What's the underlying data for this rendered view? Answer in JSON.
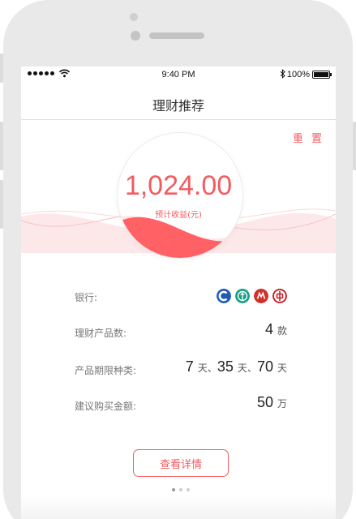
{
  "status_bar": {
    "time": "9:40 PM",
    "battery": "100%",
    "signal_icon": "signal-dots-icon",
    "wifi_icon": "wifi-icon",
    "bluetooth_icon": "bluetooth-icon"
  },
  "header": {
    "title": "理财推荐"
  },
  "actions": {
    "reset": "重 置",
    "details": "查看详情"
  },
  "summary": {
    "amount": "1,024.00",
    "amount_label": "预计收益(元)"
  },
  "colors": {
    "accent": "#f35b60",
    "wave": "#fde3e4"
  },
  "info": {
    "bank_label": "银行:",
    "banks": [
      {
        "icon": "bank-of-communications-icon",
        "color": "#1f5bb5"
      },
      {
        "icon": "agricultural-bank-icon",
        "color": "#169f85"
      },
      {
        "icon": "china-merchants-bank-icon",
        "color": "#d0302c"
      },
      {
        "icon": "bank-of-china-icon",
        "color": "#c8202a"
      }
    ],
    "products_label": "理财产品数:",
    "products_value": "4",
    "products_unit": "款",
    "periods_label": "产品期限种类:",
    "periods": [
      {
        "value": "7",
        "unit": "天"
      },
      {
        "value": "35",
        "unit": "天"
      },
      {
        "value": "70",
        "unit": "天"
      }
    ],
    "periods_sep": "、",
    "amount_label": "建议购买金额:",
    "amount_value": "50",
    "amount_unit": "万"
  },
  "pagination": {
    "total": 3,
    "active": 0
  }
}
